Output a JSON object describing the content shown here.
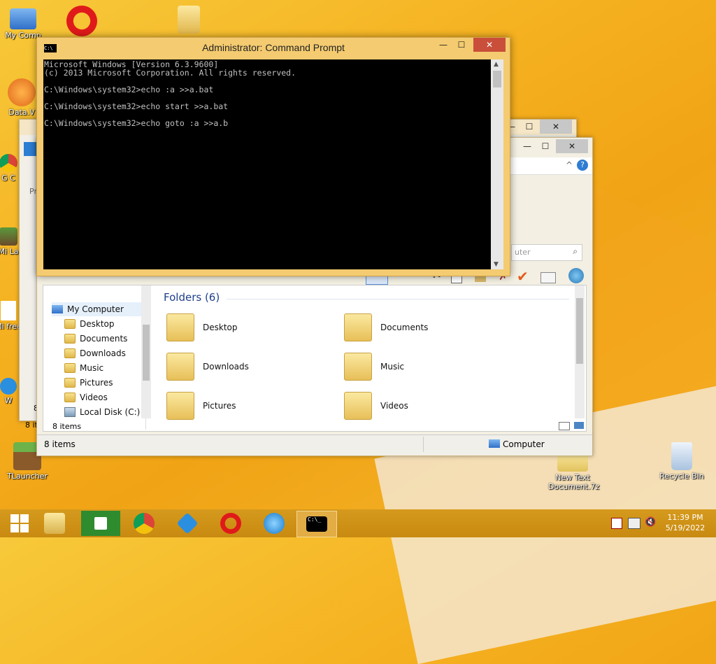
{
  "desktop": {
    "icons": [
      {
        "label": "My Comp"
      },
      {
        "label": "Data.V"
      },
      {
        "label": "G C"
      },
      {
        "label": "Mi La"
      },
      {
        "label": "Mi free"
      },
      {
        "label": "W"
      },
      {
        "label": "TLauncher"
      },
      {
        "label": "New Text Document.7z"
      },
      {
        "label": "Recycle Bin"
      }
    ]
  },
  "cmd": {
    "title": "Administrator: Command Prompt",
    "icon_text": "C:\\",
    "lines": [
      "Microsoft Windows [Version 6.3.9600]",
      "(c) 2013 Microsoft Corporation. All rights reserved.",
      "",
      "C:\\Windows\\system32>echo :a >>a.bat",
      "",
      "C:\\Windows\\system32>echo start >>a.bat",
      "",
      "C:\\Windows\\system32>echo goto :a >>a.b"
    ]
  },
  "back_window": {
    "left_labels": [
      "Pr",
      "8",
      "8 it"
    ]
  },
  "explorer": {
    "search_placeholder": "uter",
    "tree": [
      {
        "label": "My Computer"
      },
      {
        "label": "Desktop"
      },
      {
        "label": "Documents"
      },
      {
        "label": "Downloads"
      },
      {
        "label": "Music"
      },
      {
        "label": "Pictures"
      },
      {
        "label": "Videos"
      },
      {
        "label": "Local Disk (C:)"
      }
    ],
    "section_title": "Folders (6)",
    "folders": [
      {
        "label": "Desktop"
      },
      {
        "label": "Documents"
      },
      {
        "label": "Downloads"
      },
      {
        "label": "Music"
      },
      {
        "label": "Pictures"
      },
      {
        "label": "Videos"
      }
    ],
    "inner_status": "8 items",
    "status_left": "8 items",
    "status_right": "Computer"
  },
  "taskbar": {
    "time": "11:39 PM",
    "date": "5/19/2022",
    "cmd_icon_text": "C:\\_"
  }
}
